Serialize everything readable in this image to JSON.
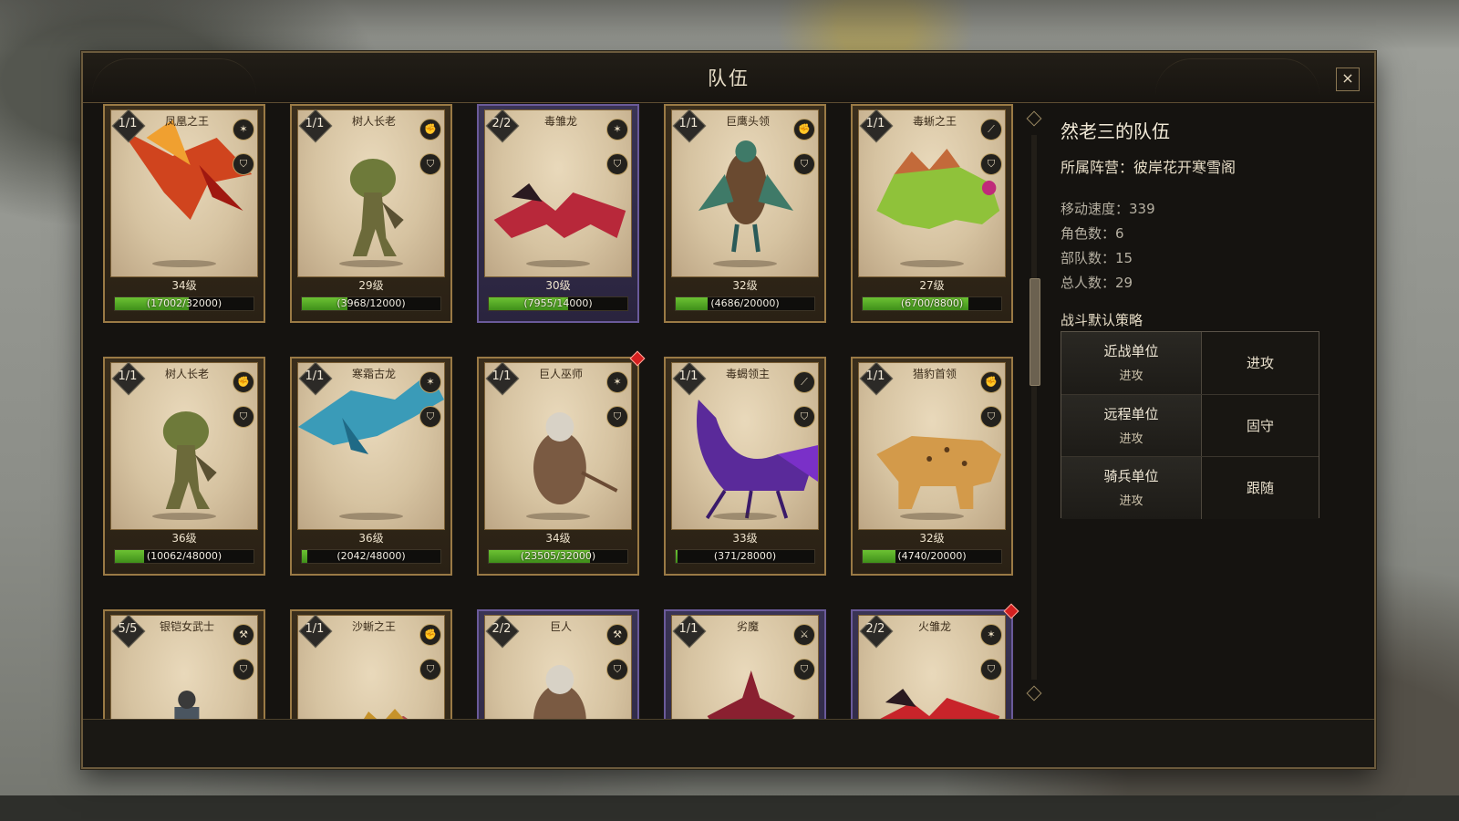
{
  "window": {
    "title": "队伍",
    "close_label": "×"
  },
  "info": {
    "team_name": "然老三的队伍",
    "faction_label": "所属阵营：",
    "faction_value": "彼岸花开寒雪阁",
    "stats": [
      {
        "label": "移动速度：",
        "value": "339"
      },
      {
        "label": "角色数：",
        "value": "6"
      },
      {
        "label": "部队数：",
        "value": "15"
      },
      {
        "label": "总人数：",
        "value": "29"
      }
    ],
    "strategy_title": "战斗默认策略",
    "strategy": [
      {
        "unit": "近战单位",
        "mode": "进攻",
        "order": "进攻"
      },
      {
        "unit": "远程单位",
        "mode": "进攻",
        "order": "固守"
      },
      {
        "unit": "骑兵单位",
        "mode": "进攻",
        "order": "跟随"
      }
    ]
  },
  "cards": [
    {
      "count": "1/1",
      "name": "凤凰之王",
      "level": "34级",
      "exp": "(17002/32000)",
      "progress": 0.53,
      "creature": "phoenix",
      "color": "#d0441e",
      "rare": false,
      "alert": false,
      "type_icon": "claw-icon",
      "shield_icon": "shield-icon"
    },
    {
      "count": "1/1",
      "name": "树人长老",
      "level": "29级",
      "exp": "(3968/12000)",
      "progress": 0.33,
      "creature": "treant",
      "color": "#6c6a3a",
      "rare": false,
      "alert": false,
      "type_icon": "fist-icon",
      "shield_icon": "shield-icon"
    },
    {
      "count": "2/2",
      "name": "毒雏龙",
      "level": "30级",
      "exp": "(7955/14000)",
      "progress": 0.57,
      "creature": "dragon",
      "color": "#b8283a",
      "rare": true,
      "alert": false,
      "type_icon": "claw-icon",
      "shield_icon": "shield-icon"
    },
    {
      "count": "1/1",
      "name": "巨鹰头领",
      "level": "32级",
      "exp": "(4686/20000)",
      "progress": 0.23,
      "creature": "eagle",
      "color": "#3f7a68",
      "rare": false,
      "alert": false,
      "type_icon": "fist-icon",
      "shield_icon": "shield-icon"
    },
    {
      "count": "1/1",
      "name": "毒蜥之王",
      "level": "27级",
      "exp": "(6700/8800)",
      "progress": 0.76,
      "creature": "lizard",
      "color": "#8fc23a",
      "rare": false,
      "alert": false,
      "type_icon": "fang-icon",
      "shield_icon": "shield-icon"
    },
    {
      "count": "1/1",
      "name": "树人长老",
      "level": "36级",
      "exp": "(10062/48000)",
      "progress": 0.21,
      "creature": "treant",
      "color": "#6c6a3a",
      "rare": false,
      "alert": false,
      "type_icon": "fist-icon",
      "shield_icon": "shield-icon"
    },
    {
      "count": "1/1",
      "name": "寒霜古龙",
      "level": "36级",
      "exp": "(2042/48000)",
      "progress": 0.04,
      "creature": "frostdragon",
      "color": "#3a9bb8",
      "rare": false,
      "alert": false,
      "type_icon": "claw-icon",
      "shield_icon": "shield-icon"
    },
    {
      "count": "1/1",
      "name": "巨人巫师",
      "level": "34级",
      "exp": "(23505/32000)",
      "progress": 0.73,
      "creature": "giant",
      "color": "#7a5a42",
      "rare": false,
      "alert": true,
      "type_icon": "claw-icon",
      "shield_icon": "shield-icon"
    },
    {
      "count": "1/1",
      "name": "毒蝎领主",
      "level": "33级",
      "exp": "(371/28000)",
      "progress": 0.01,
      "creature": "scorpion",
      "color": "#5a2a9a",
      "rare": false,
      "alert": false,
      "type_icon": "fang-icon",
      "shield_icon": "shield-icon"
    },
    {
      "count": "1/1",
      "name": "猎豹首领",
      "level": "32级",
      "exp": "(4740/20000)",
      "progress": 0.24,
      "creature": "leopard",
      "color": "#d39a4a",
      "rare": false,
      "alert": false,
      "type_icon": "fist-icon",
      "shield_icon": "shield-icon"
    },
    {
      "count": "5/5",
      "name": "银铠女武士",
      "level": "",
      "exp": "",
      "progress": 0,
      "creature": "warrior",
      "color": "#4a5560",
      "rare": false,
      "alert": false,
      "type_icon": "axe-icon",
      "shield_icon": "shield-icon"
    },
    {
      "count": "1/1",
      "name": "沙蜥之王",
      "level": "",
      "exp": "",
      "progress": 0,
      "creature": "sandlizard",
      "color": "#b0464a",
      "rare": false,
      "alert": false,
      "type_icon": "fist-icon",
      "shield_icon": "shield-icon"
    },
    {
      "count": "2/2",
      "name": "巨人",
      "level": "",
      "exp": "",
      "progress": 0,
      "creature": "giant",
      "color": "#7a5a42",
      "rare": true,
      "alert": false,
      "type_icon": "hammer-icon",
      "shield_icon": "shield-icon"
    },
    {
      "count": "1/1",
      "name": "劣魔",
      "level": "",
      "exp": "",
      "progress": 0,
      "creature": "imp",
      "color": "#8a2030",
      "rare": true,
      "alert": false,
      "type_icon": "sword-icon",
      "shield_icon": "shield-icon"
    },
    {
      "count": "2/2",
      "name": "火雏龙",
      "level": "",
      "exp": "",
      "progress": 0,
      "creature": "dragon",
      "color": "#c8242a",
      "rare": true,
      "alert": true,
      "type_icon": "claw-icon",
      "shield_icon": "shield-icon"
    }
  ]
}
